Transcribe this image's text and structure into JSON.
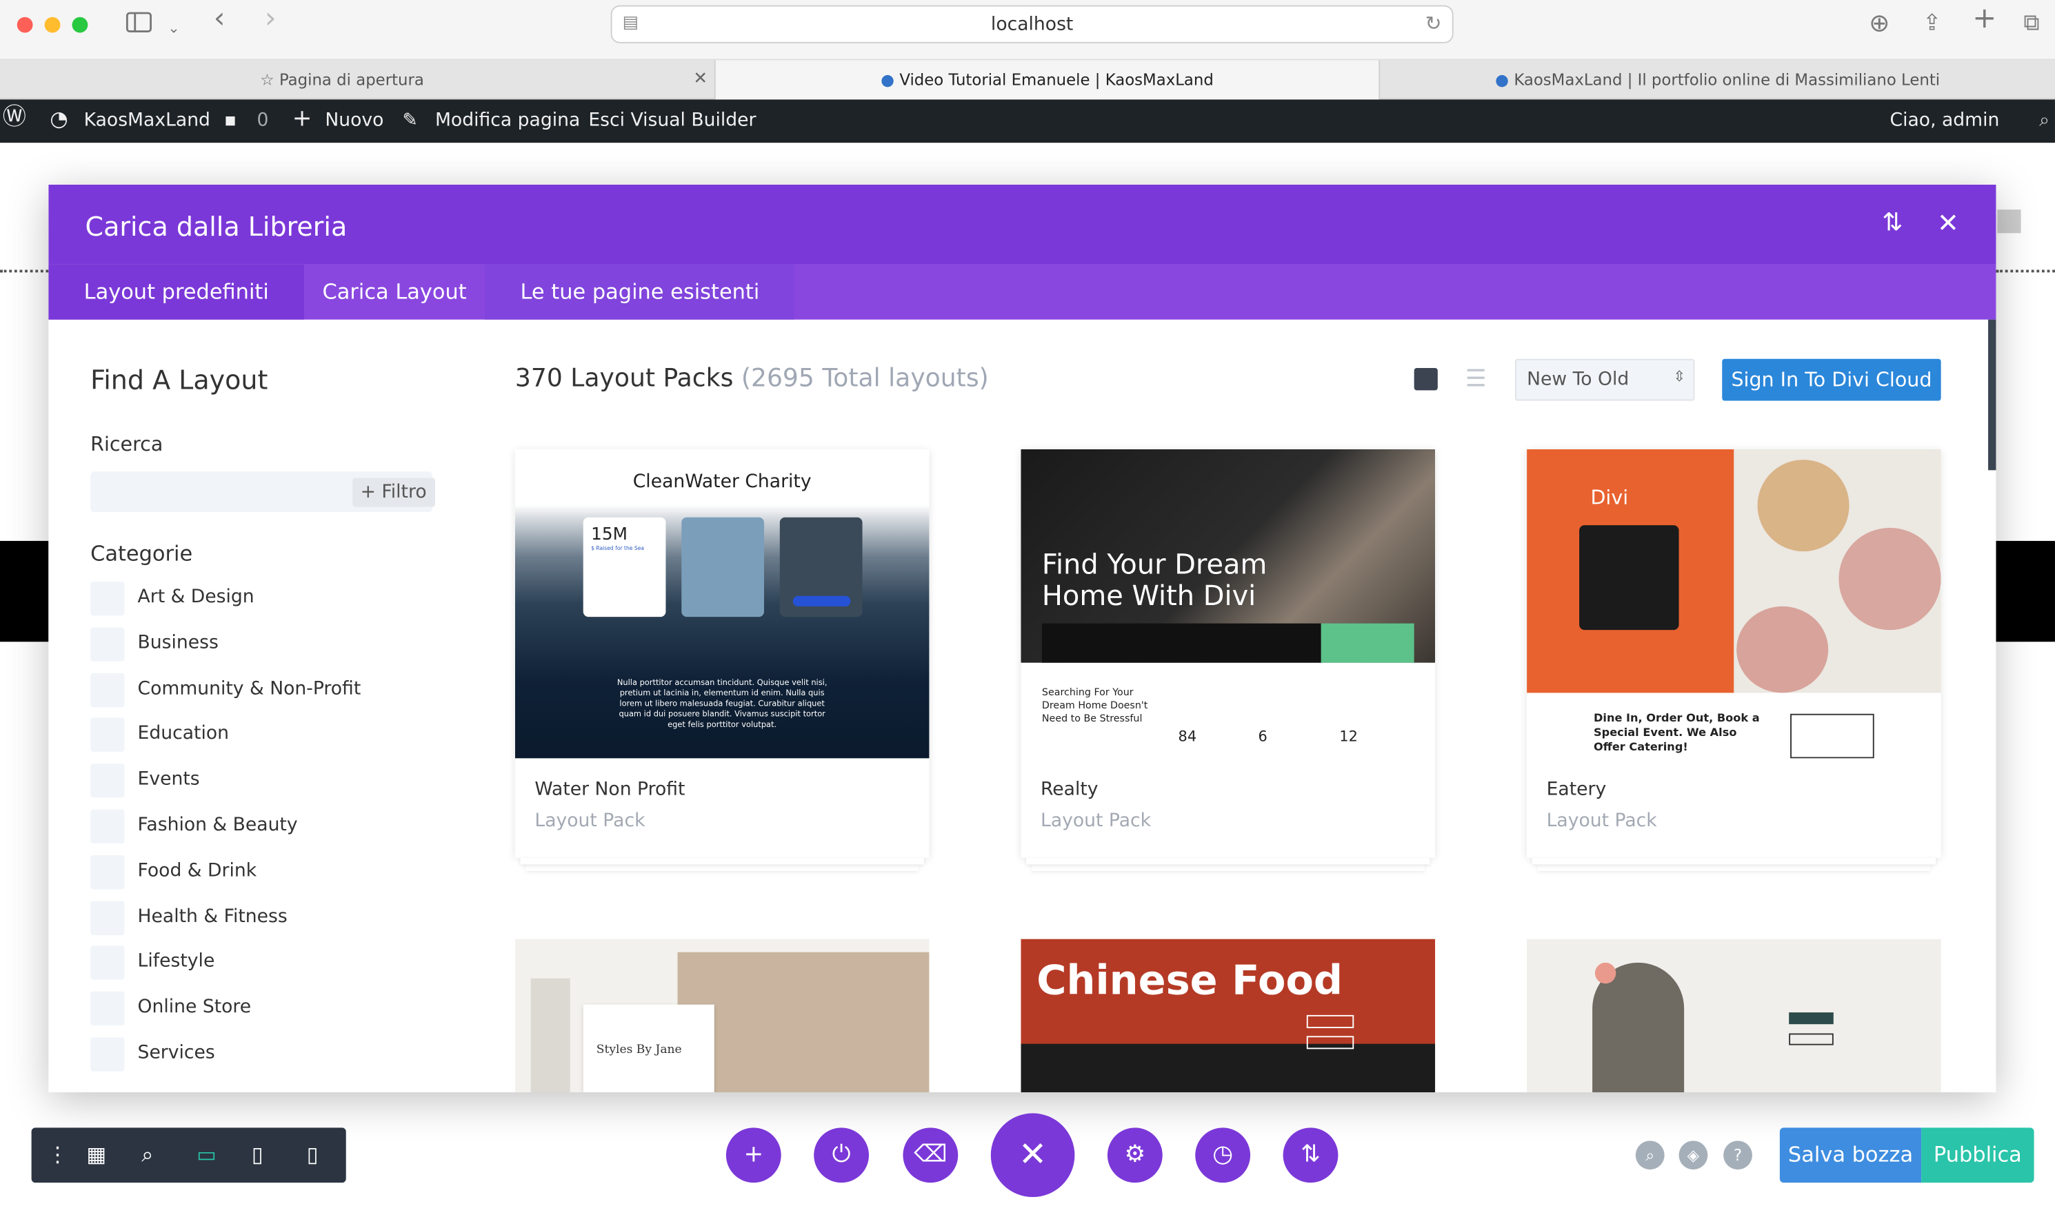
{
  "browser": {
    "url": "localhost",
    "tabs": [
      {
        "label": "Pagina di apertura"
      },
      {
        "label": "Video Tutorial Emanuele | KaosMaxLand"
      },
      {
        "label": "KaosMaxLand | Il portfolio online di Massimiliano Lenti"
      }
    ]
  },
  "adminbar": {
    "site": "KaosMaxLand",
    "comments": "0",
    "new": "Nuovo",
    "edit": "Modifica pagina",
    "exit": "Esci Visual Builder",
    "greeting": "Ciao, admin"
  },
  "modal": {
    "title": "Carica dalla Libreria",
    "tabs": [
      {
        "label": "Layout predefiniti",
        "active": true
      },
      {
        "label": "Carica Layout",
        "active": false
      },
      {
        "label": "Le tue pagine esistenti",
        "active": false
      }
    ],
    "sidebar": {
      "heading": "Find A Layout",
      "search_label": "Ricerca",
      "filter_label": "+ Filtro",
      "categories_label": "Categorie",
      "categories": [
        "Art & Design",
        "Business",
        "Community & Non-Profit",
        "Education",
        "Events",
        "Fashion & Beauty",
        "Food & Drink",
        "Health & Fitness",
        "Lifestyle",
        "Online Store",
        "Services"
      ]
    },
    "main": {
      "packs_count": "370 Layout Packs",
      "total_layouts": "(2695 Total layouts)",
      "sort_value": "New To Old",
      "signin_label": "Sign In To Divi Cloud",
      "cards": [
        {
          "name": "Water Non Profit",
          "type": "Layout Pack"
        },
        {
          "name": "Realty",
          "type": "Layout Pack"
        },
        {
          "name": "Eatery",
          "type": "Layout Pack"
        }
      ],
      "thumbs": {
        "water": {
          "title": "CleanWater Charity",
          "stat": "15M",
          "stat_sub": "$ Raised for the Sea",
          "body": "Nulla porttitor accumsan tincidunt. Quisque velit nisi, pretium ut lacinia in, elementum id enim. Nulla quis lorem ut libero malesuada feugiat. Curabitur aliquet quam id dui posuere blandit. Vivamus suscipit tortor eget felis porttitor volutpat."
        },
        "realty": {
          "headline": "Find Your Dream Home With Divi",
          "sub": "Searching For Your Dream Home Doesn't Need to Be Stressful",
          "stats": [
            "84",
            "6",
            "12"
          ]
        },
        "eatery": {
          "brand": "Divi",
          "text": "Dine In, Order Out, Book a Special Event. We Also Offer Catering!"
        },
        "styles": {
          "text": "Styles By Jane"
        },
        "chinese": {
          "title": "Chinese Food"
        }
      }
    }
  },
  "footer": {
    "save_draft": "Salva bozza",
    "publish": "Pubblica"
  }
}
